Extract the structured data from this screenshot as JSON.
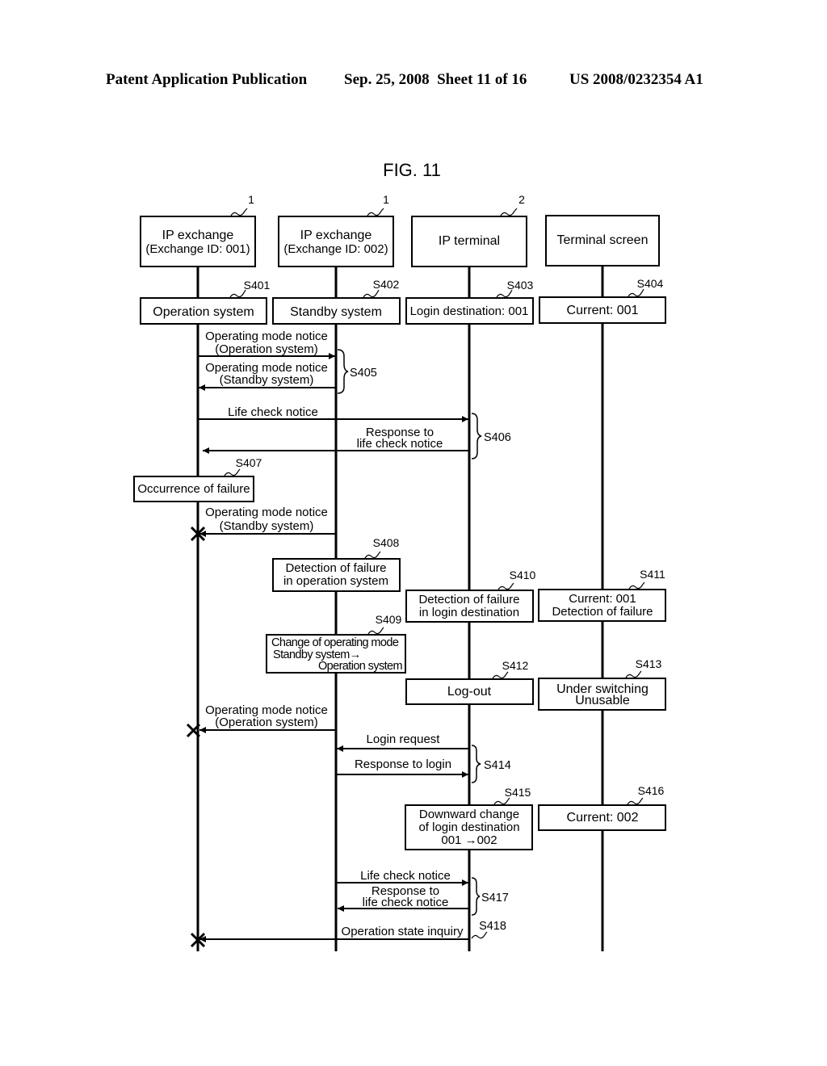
{
  "header": {
    "publication": "Patent Application Publication",
    "date_sheet": "Sep. 25, 2008  Sheet 11 of 16",
    "patent_number": "US 2008/0232354 A1"
  },
  "figure": {
    "title": "FIG. 11",
    "actors": [
      {
        "ref": "1",
        "line1": "IP exchange",
        "line2": "(Exchange ID: 001)"
      },
      {
        "ref": "1",
        "line1": "IP exchange",
        "line2": "(Exchange ID: 002)"
      },
      {
        "ref": "2",
        "line1": "IP terminal",
        "line2": ""
      },
      {
        "ref": "",
        "line1": "Terminal screen",
        "line2": ""
      }
    ],
    "states": {
      "s401": {
        "step": "S401",
        "text": "Operation system"
      },
      "s402": {
        "step": "S402",
        "text": "Standby system"
      },
      "s403": {
        "step": "S403",
        "text": "Login destination: 001"
      },
      "s404": {
        "step": "S404",
        "text": "Current: 001"
      },
      "s407": {
        "step": "S407",
        "text": "Occurrence of failure"
      },
      "s408": {
        "step": "S408",
        "line1": "Detection of failure",
        "line2": "in operation system"
      },
      "s409": {
        "step": "S409",
        "line1": "Change of operating mode",
        "line2": "Standby system→",
        "line3": "Operation system"
      },
      "s410": {
        "step": "S410",
        "line1": "Detection of failure",
        "line2": "in login destination"
      },
      "s411": {
        "step": "S411",
        "line1": "Current: 001",
        "line2": "Detection of failure"
      },
      "s412": {
        "step": "S412",
        "text": "Log-out"
      },
      "s413": {
        "step": "S413",
        "line1": "Under switching",
        "line2": "Unusable"
      },
      "s415": {
        "step": "S415",
        "line1": "Downward change",
        "line2": "of login destination",
        "line3": "001 →002"
      },
      "s416": {
        "step": "S416",
        "text": "Current: 002"
      }
    },
    "messages": {
      "m1": {
        "line1": "Operating mode notice",
        "line2": "(Operation system)"
      },
      "m2": {
        "line1": "Operating mode notice",
        "line2": "(Standby system)"
      },
      "m3": {
        "text": "Life check notice"
      },
      "m4": {
        "line1": "Response to",
        "line2": "life check notice"
      },
      "m5": {
        "line1": "Operating mode notice",
        "line2": "(Standby system)"
      },
      "m6": {
        "line1": "Operating mode notice",
        "line2": "(Operation system)"
      },
      "m7": {
        "text": "Login request"
      },
      "m8": {
        "text": "Response to login"
      },
      "m9": {
        "text": "Life check notice"
      },
      "m10": {
        "line1": "Response to",
        "line2": "life check notice"
      },
      "m11": {
        "text": "Operation state inquiry"
      }
    },
    "groups": {
      "s405": "S405",
      "s406": "S406",
      "s414": "S414",
      "s417": "S417",
      "s418": "S418"
    }
  }
}
